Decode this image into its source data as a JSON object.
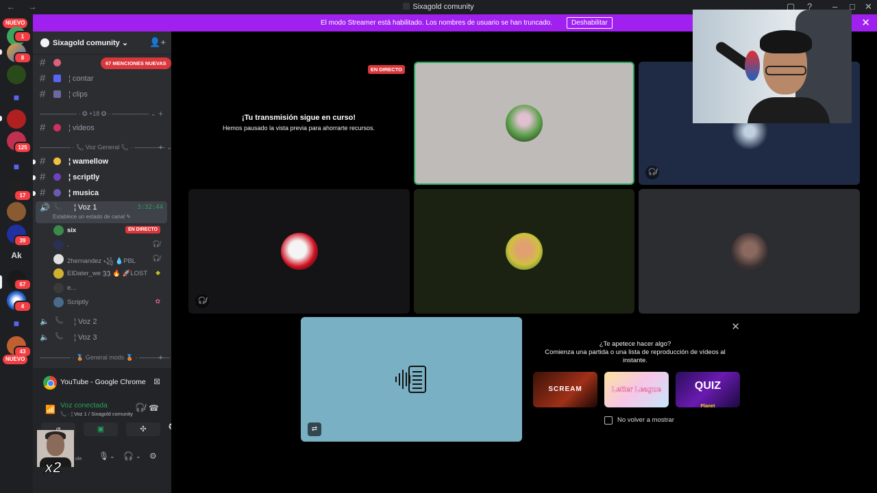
{
  "window": {
    "title": "Sixagold comunity",
    "nav_glyph": "← →",
    "controls": [
      "▢",
      "?",
      "–",
      "□",
      "✕"
    ]
  },
  "banner": {
    "message": "El modo Streamer está habilitado. Los nombres de usuario se han truncado.",
    "button": "Deshabilitar",
    "close_glyph": "✕"
  },
  "guilds": {
    "new_label": "NUEVO",
    "badges": [
      "1",
      "8",
      "125",
      "17",
      "39",
      "67",
      "4",
      "43"
    ],
    "text_server": "Ak",
    "folder_glyph": "■"
  },
  "sidebar": {
    "server_name": "Sixagold comunity",
    "chevron": "⌄",
    "invite_glyph": "👤+",
    "mentions_pill": "67 MENCIONES NUEVAS",
    "channels": [
      {
        "label": "¦ contar"
      },
      {
        "label": "¦ clips"
      },
      {
        "label": "¦ videos"
      },
      {
        "label": "¦ wamellow"
      },
      {
        "label": "¦ scriptly"
      },
      {
        "label": "¦ musica"
      }
    ],
    "categories": [
      {
        "label": "—————— · ✪ +18 ✪ · —————— ⌄"
      },
      {
        "label": "————— · 📞 Voz General 📞 · ————— ⌄"
      },
      {
        "label": "————— · 🥉 General mods 🥉 · ————— ⌄"
      }
    ],
    "active_voice": {
      "label": "¦ Voz 1",
      "time": "3:32:44",
      "status": "Establece un estado de canal ✎"
    },
    "members": [
      {
        "name": "six",
        "badge": "EN DIRECTO",
        "right": ""
      },
      {
        "name": ".",
        "badge": "",
        "right": "🎧̸"
      },
      {
        "name": "2hernandez ꧁ 💧PBL",
        "badge": "",
        "right": "🎧̸"
      },
      {
        "name": "ElDater_we 𝕵𝕵 🔥 🚀LOST",
        "badge": "",
        "right": "◆"
      },
      {
        "name": "e...",
        "badge": "",
        "right": ""
      },
      {
        "name": "Scriptly",
        "badge": "",
        "right": "✿"
      }
    ],
    "other_voice": [
      {
        "label": "¦ Voz 2"
      },
      {
        "label": "¦ Voz 3"
      }
    ],
    "plus": "+"
  },
  "panel": {
    "app_title": "YouTube - Google Chrome",
    "app_close": "⊠",
    "connected": "Voz conectada",
    "connected_sub": "📞 · ¦ Voz 1 / Sixagold comunity",
    "actions": [
      "⌀",
      "▣",
      "✣",
      "✪"
    ],
    "user_sub": "ole",
    "overlay_text": "x2",
    "mic": "🎙",
    "headset": "🎧",
    "settings": "⚙",
    "signal": "📶",
    "hangup": "☎",
    "deafen": "🎧̸"
  },
  "stage": {
    "live_label": "EN DIRECTO",
    "paused_title": "¡Tu transmisión sigue en curso!",
    "paused_sub": "Hemos pausado la vista previa para ahorrarte recursos.",
    "mute_glyph": "🎧̸",
    "stream_glyph": "⇄",
    "tile_colors": {
      "speaking_tile": "#bfbbb8",
      "speaking_border": "#23a55a",
      "tile_navy": "#1f2a44",
      "tile_dark": "#141416",
      "tile_olive": "#1c2212",
      "tile_grey": "#2b2d31",
      "stream_tile": "#7ab0c4"
    }
  },
  "activity": {
    "close": "✕",
    "heading": "¿Te apetece hacer algo?",
    "sub": "Comienza una partida o una lista de reproducción de vídeos al instante.",
    "games": [
      {
        "name": "SCREAM"
      },
      {
        "name": "Letter League"
      },
      {
        "name": "QUIZ",
        "sub": "Planet"
      }
    ],
    "checkbox_label": "No volver a mostrar"
  },
  "colors": {
    "accent_purple": "#a020f0",
    "live_red": "#da373c",
    "voice_green": "#23a55a"
  }
}
